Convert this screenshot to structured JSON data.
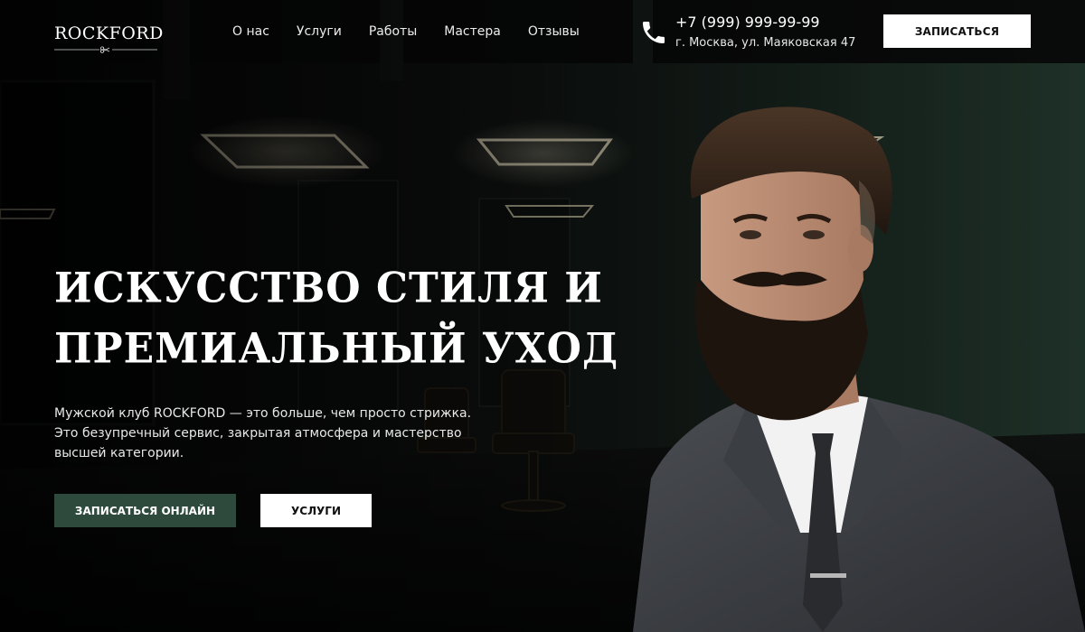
{
  "brand": {
    "name": "ROCKFORD",
    "logo_icon": "scissors-icon"
  },
  "nav": {
    "items": [
      {
        "label": "О нас"
      },
      {
        "label": "Услуги"
      },
      {
        "label": "Работы"
      },
      {
        "label": "Мастера"
      },
      {
        "label": "Отзывы"
      }
    ]
  },
  "contact": {
    "phone_icon": "phone-icon",
    "phone": "+7 (999) 999-99-99",
    "address": "г. Москва, ул. Маяковская 47"
  },
  "header": {
    "book_label": "ЗАПИСАТЬСЯ"
  },
  "hero": {
    "title_line1": "Искусство стиля и",
    "title_line2": "премиальный уход",
    "description": "Мужской клуб ROCKFORD — это больше, чем просто стрижка. Это безупречный сервис, закрытая атмосфера и мастерство высшей категории.",
    "cta_primary": "ЗАПИСАТЬСЯ ОНЛАЙН",
    "cta_secondary": "УСЛУГИ"
  },
  "colors": {
    "accent_green": "#2e4a3d",
    "background": "#0d0f0e",
    "text_light": "#ffffff"
  }
}
